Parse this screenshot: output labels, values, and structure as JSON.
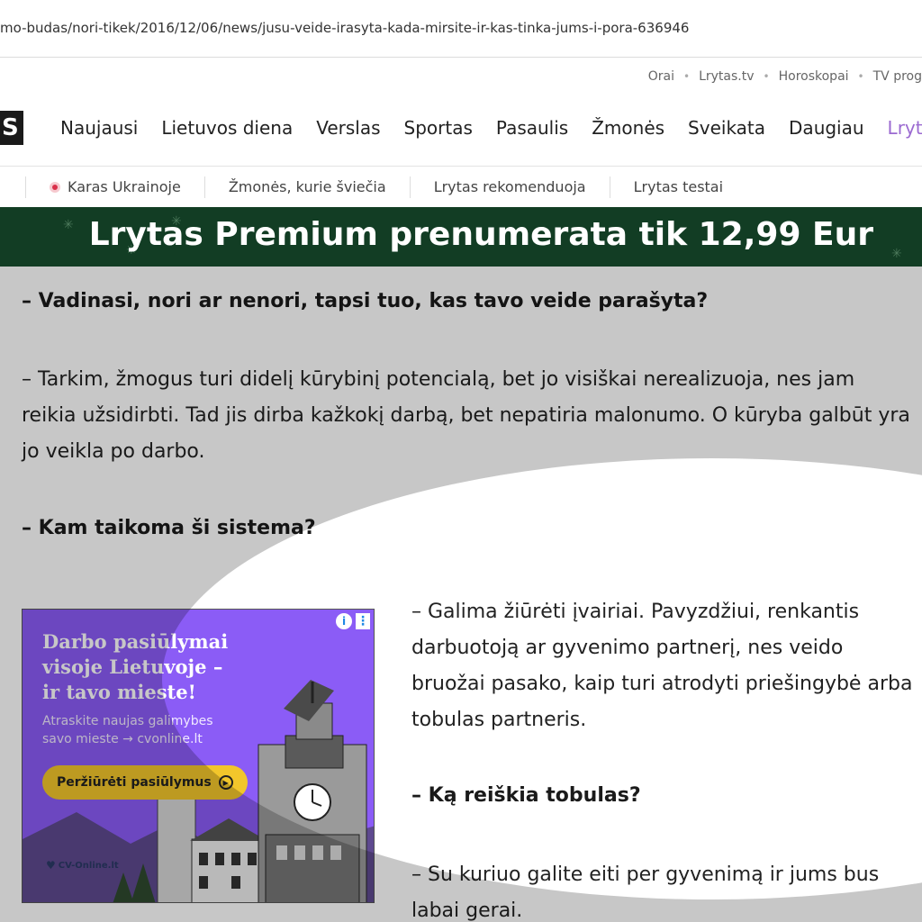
{
  "browser": {
    "url": "mo-budas/nori-tikek/2016/12/06/news/jusu-veide-irasyta-kada-mirsite-ir-kas-tinka-jums-i-pora-636946"
  },
  "utility_links": [
    "Orai",
    "Lrytas.tv",
    "Horoskopai",
    "TV prog"
  ],
  "logo": {
    "text": "S"
  },
  "main_nav": [
    "Naujausi",
    "Lietuvos diena",
    "Verslas",
    "Sportas",
    "Pasaulis",
    "Žmonės",
    "Sveikata",
    "Daugiau",
    "Lrytas"
  ],
  "sub_nav": [
    "Karas Ukrainoje",
    "Žmonės, kurie šviečia",
    "Lrytas rekomenduoja",
    "Lrytas testai"
  ],
  "banner": {
    "text": "Lrytas Premium prenumerata tik 12,99 Eur"
  },
  "article": {
    "q1": "– Vadinasi, nori ar nenori, tapsi tuo, kas tavo veide parašyta?",
    "p1": "– Tarkim, žmogus turi didelį kūrybinį potencialą, bet jo visiškai nerealizuoja, nes jam reikia užsidirbti. Tad jis dirba kažkokį darbą, bet nepatiria malonumo. O kūryba galbūt yra jo veikla po darbo.",
    "q2": "– Kam taikoma ši sistema?",
    "p2": "– Galima žiūrėti įvairiai. Pavyzdžiui, renkantis darbuotoją ar gyvenimo partnerį, nes veido bruožai pasako, kaip turi atrodyti priešingybė arba tobulas partneris.",
    "q3": "– Ką reiškia tobulas?",
    "p3": "– Su kuriuo galite eiti per gyvenimą ir jums bus labai gerai."
  },
  "ad": {
    "headline": "Darbo pasiūlymai visoje Lietuvoje – ir tavo mieste!",
    "subtext": "Atraskite naujas galimybes savo mieste → cvonline.lt",
    "cta": "Peržiūrėti pasiūlymus",
    "brand": "CV-Online.lt",
    "info_icon": "i",
    "more_icon": "⋮"
  },
  "colors": {
    "banner_bg": "#123d24",
    "premium_accent": "#9b6ad1",
    "ad_bg": "#8b5cf6",
    "ad_cta": "#f2c62b",
    "dim_overlay": "rgba(0,0,0,0.22)"
  }
}
